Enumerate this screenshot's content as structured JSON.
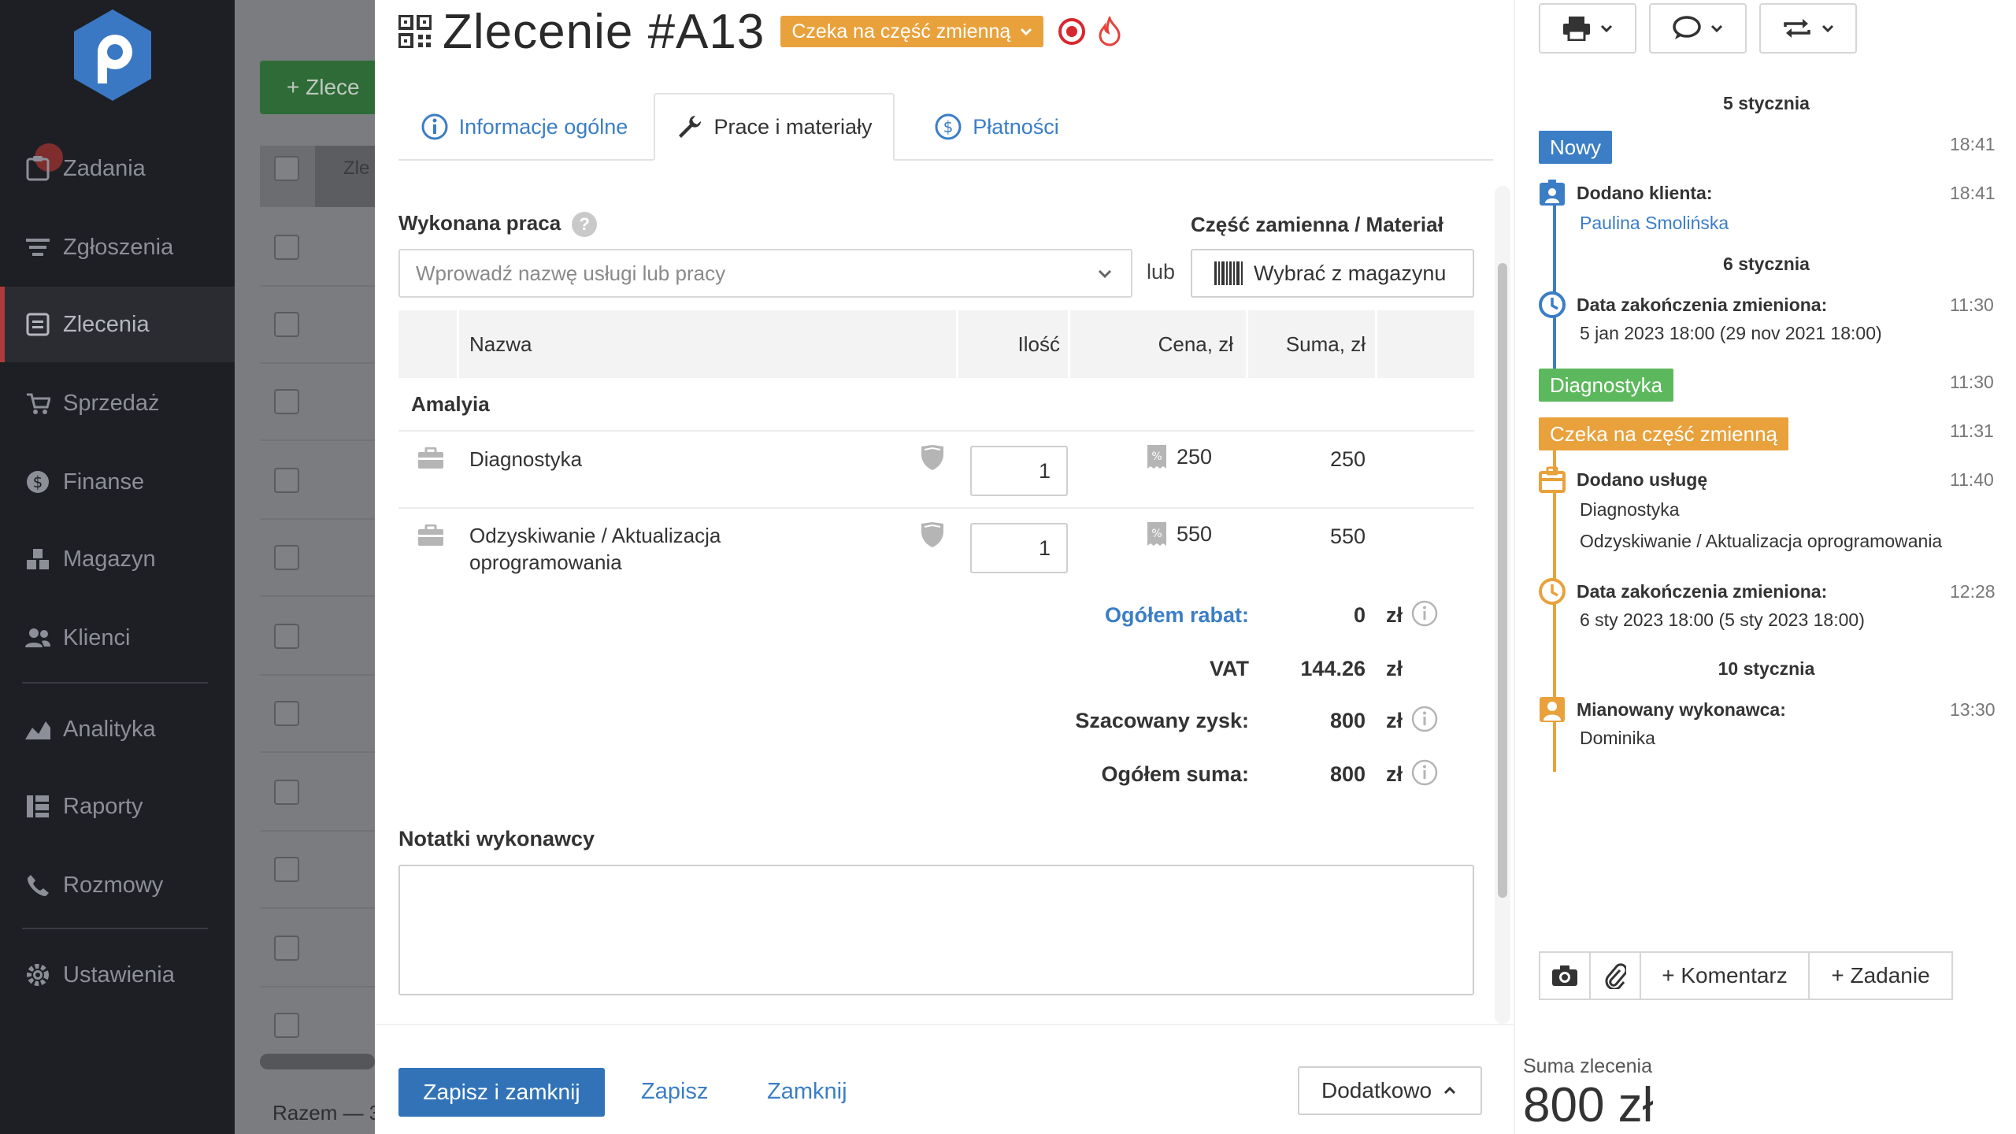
{
  "sidebar": {
    "badge": "1",
    "items": [
      {
        "label": "Zadania",
        "icon": "tasks-icon"
      },
      {
        "label": "Zgłoszenia",
        "icon": "requests-icon"
      },
      {
        "label": "Zlecenia",
        "icon": "orders-icon"
      },
      {
        "label": "Sprzedaż",
        "icon": "cart-icon"
      },
      {
        "label": "Finanse",
        "icon": "dollar-icon"
      },
      {
        "label": "Magazyn",
        "icon": "warehouse-icon"
      },
      {
        "label": "Klienci",
        "icon": "clients-icon"
      },
      {
        "label": "Analityka",
        "icon": "analytics-icon"
      },
      {
        "label": "Raporty",
        "icon": "reports-icon"
      },
      {
        "label": "Rozmowy",
        "icon": "phone-icon"
      },
      {
        "label": "Ustawienia",
        "icon": "gear-icon"
      }
    ]
  },
  "background": {
    "new_order_label": "+ Zlece",
    "header_text": "Zle",
    "footer_text": "Razem — 3"
  },
  "order": {
    "title": "Zlecenie #A13",
    "status": "Czeka na część zmienną",
    "colors": {
      "status": "#e9a13b",
      "accent": "#3273b8",
      "link": "#3b7ec6",
      "new": "#3b7ec6",
      "diagnostics": "#5cb85c"
    }
  },
  "tabs": [
    {
      "label": "Informacje ogólne",
      "icon": "info-icon"
    },
    {
      "label": "Prace i materiały",
      "icon": "wrench-icon"
    },
    {
      "label": "Płatności",
      "icon": "dollar-icon"
    }
  ],
  "work": {
    "label": "Wykonana praca",
    "help": "?",
    "service_placeholder": "Wprowadź nazwę usługi lub pracy",
    "or_label": "lub",
    "part_label": "Część zamienna / Materiał",
    "warehouse_button": "Wybrać z magazynu"
  },
  "table": {
    "columns": {
      "name": "Nazwa",
      "qty": "Ilość",
      "price": "Cena, zł",
      "sum": "Suma, zł"
    },
    "group": "Amalyia",
    "rows": [
      {
        "name": "Diagnostyka",
        "qty": "1",
        "price": "250",
        "sum": "250"
      },
      {
        "name": "Odzyskiwanie / Aktualizacja oprogramowania",
        "qty": "1",
        "price": "550",
        "sum": "550"
      }
    ]
  },
  "totals": {
    "discount": {
      "label": "Ogółem rabat:",
      "value": "0",
      "currency": "zł"
    },
    "vat": {
      "label": "VAT",
      "value": "144.26",
      "currency": "zł"
    },
    "profit": {
      "label": "Szacowany zysk:",
      "value": "800",
      "currency": "zł"
    },
    "total": {
      "label": "Ogółem suma:",
      "value": "800",
      "currency": "zł"
    }
  },
  "notes": {
    "label": "Notatki wykonawcy",
    "value": ""
  },
  "footer": {
    "save_close": "Zapisz i zamknij",
    "save": "Zapisz",
    "close": "Zamknij",
    "more": "Dodatkowo"
  },
  "timeline": {
    "days": [
      "5 stycznia",
      "6 stycznia",
      "10 stycznia"
    ],
    "events": [
      {
        "type": "tag",
        "text": "Nowy",
        "time": "18:41"
      },
      {
        "type": "event",
        "title": "Dodano klienta:",
        "lines": [
          "Paulina Smolińska"
        ],
        "time": "18:41"
      },
      {
        "type": "event",
        "title": "Data zakończenia zmieniona:",
        "lines": [
          "5 jan 2023 18:00 (29 nov 2021 18:00)"
        ],
        "time": "11:30"
      },
      {
        "type": "tag",
        "text": "Diagnostyka",
        "time": "11:30"
      },
      {
        "type": "tag",
        "text": "Czeka na część zmienną",
        "time": "11:31"
      },
      {
        "type": "event",
        "title": "Dodano usługę",
        "lines": [
          "Diagnostyka",
          "Odzyskiwanie / Aktualizacja oprogramowania"
        ],
        "time": "11:40"
      },
      {
        "type": "event",
        "title": "Data zakończenia zmieniona:",
        "lines": [
          "6 sty 2023 18:00 (5 sty 2023 18:00)"
        ],
        "time": "12:28"
      },
      {
        "type": "event",
        "title": "Mianowany wykonawca:",
        "lines": [
          "Dominika"
        ],
        "time": "13:30"
      }
    ]
  },
  "right_actions": {
    "comment": "+ Komentarz",
    "task": "+ Zadanie"
  },
  "order_sum": {
    "label": "Suma zlecenia",
    "value": "800 zł"
  }
}
